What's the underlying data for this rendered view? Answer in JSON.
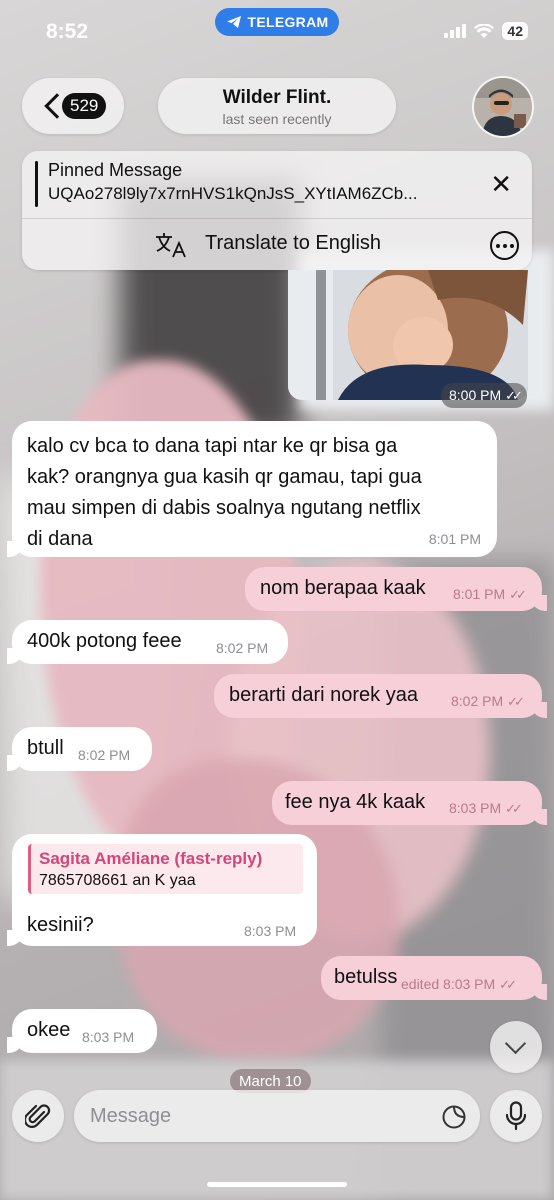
{
  "status_bar": {
    "time": "8:52",
    "source_app": "TELEGRAM",
    "battery": "42"
  },
  "header": {
    "back_badge": "529",
    "chat_name": "Wilder Flint.",
    "chat_status": "last seen recently"
  },
  "pinned": {
    "title": "Pinned Message",
    "text": "UQAo278l9ly7x7rnHVS1kQnJsS_XYtIAM6ZCb...",
    "translate_label": "Translate to English"
  },
  "photo_message": {
    "time": "8:00 PM"
  },
  "messages": [
    {
      "direction": "in",
      "lines": [
        "kalo cv bca to dana tapi ntar ke qr bisa ga",
        "kak? orangnya gua kasih qr gamau, tapi gua",
        "mau simpen di dabis soalnya ngutang netflix",
        "di dana"
      ],
      "time": "8:01 PM"
    },
    {
      "direction": "out",
      "text": "nom berapaa kaak",
      "time": "8:01 PM"
    },
    {
      "direction": "in",
      "text": "400k potong feee",
      "time": "8:02 PM"
    },
    {
      "direction": "out",
      "text": "berarti dari norek yaa",
      "time": "8:02 PM"
    },
    {
      "direction": "in",
      "text": "btull",
      "time": "8:02 PM"
    },
    {
      "direction": "out",
      "text": "fee nya 4k kaak",
      "time": "8:03 PM"
    },
    {
      "direction": "in",
      "reply_name": "Sagita Améliane (fast-reply)",
      "reply_text": "7865708661 an K yaa",
      "text": "kesinii?",
      "time": "8:03 PM"
    },
    {
      "direction": "out",
      "text": "betulss",
      "time": "edited 8:03 PM"
    },
    {
      "direction": "in",
      "text": "okee",
      "time": "8:03 PM"
    }
  ],
  "date_separator": "March 10",
  "composer": {
    "placeholder": "Message"
  },
  "colors": {
    "outgoing_bubble": "#f6cfd9",
    "incoming_bubble": "#ffffff",
    "telegram_blue": "#2f7de8",
    "reply_accent": "#e05b80"
  }
}
